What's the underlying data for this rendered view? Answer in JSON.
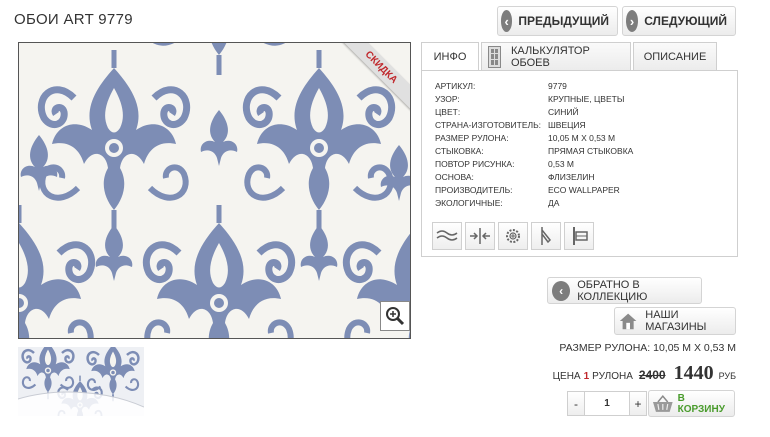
{
  "product": {
    "title": "ОБОИ ART 9779",
    "sale_badge": "СКИДКА"
  },
  "nav": {
    "prev_label": "ПРЕДЫДУЩИЙ",
    "next_label": "СЛЕДУЮЩИЙ"
  },
  "tabs": [
    {
      "label": "ИНФО",
      "active": true
    },
    {
      "label": "КАЛЬКУЛЯТОР ОБОЕВ",
      "active": false
    },
    {
      "label": "ОПИСАНИЕ",
      "active": false
    }
  ],
  "specs": [
    {
      "key": "АРТИКУЛ:",
      "value": "9779"
    },
    {
      "key": "УЗОР:",
      "value": "КРУПНЫЕ, ЦВЕТЫ"
    },
    {
      "key": "ЦВЕТ:",
      "value": "СИНИЙ"
    },
    {
      "key": "СТРАНА-ИЗГОТОВИТЕЛЬ:",
      "value": "ШВЕЦИЯ"
    },
    {
      "key": "РАЗМЕР РУЛОНА:",
      "value": "10,05 М Х 0,53 М"
    },
    {
      "key": "СТЫКОВКА:",
      "value": "ПРЯМАЯ СТЫКОВКА"
    },
    {
      "key": "ПОВТОР РИСУНКА:",
      "value": "0,53 М"
    },
    {
      "key": "ОСНОВА:",
      "value": "ФЛИЗЕЛИН"
    },
    {
      "key": "ПРОИЗВОДИТЕЛЬ:",
      "value": "ECO WALLPAPER"
    },
    {
      "key": "ЭКОЛОГИЧНЫЕ:",
      "value": "ДА"
    }
  ],
  "feature_icons": [
    "wave-icon",
    "join-icon",
    "gear-icon",
    "knife-icon",
    "level-icon"
  ],
  "actions": {
    "back_label": "ОБРАТНО В КОЛЛЕКЦИЮ",
    "shops_label": "НАШИ МАГАЗИНЫ",
    "cart_label": "В КОРЗИНУ"
  },
  "pricing": {
    "roll_size": "РАЗМЕР РУЛОНА: 10,05 М Х 0,53 М",
    "price_label": "ЦЕНА",
    "price_qty": "1",
    "price_unit": "РУЛОНА",
    "old_price": "2400",
    "new_price": "1440",
    "currency": "РУБ"
  },
  "quantity": {
    "minus": "-",
    "value": "1",
    "plus": "+"
  },
  "colors": {
    "pattern_blue": "#7d8db5",
    "pattern_bg": "#f5f4f0",
    "sale_red": "#c0282d",
    "cart_green": "#4a9c2d"
  }
}
